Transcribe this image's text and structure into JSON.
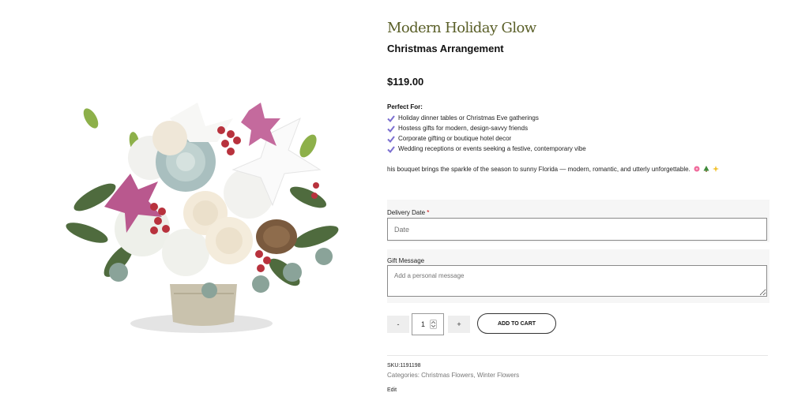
{
  "product": {
    "title": "Modern Holiday Glow",
    "subtitle": "Christmas Arrangement",
    "price": "$119.00"
  },
  "perfect_for": {
    "heading": "Perfect For:",
    "items": [
      "Holiday dinner tables or Christmas Eve gatherings",
      "Hostess gifts for modern, design-savvy friends",
      "Corporate gifting or boutique hotel decor",
      "Wedding receptions or events seeking a festive, contemporary vibe"
    ]
  },
  "description": {
    "text": "his bouquet brings the sparkle of the season to sunny Florida — modern, romantic, and utterly unforgettable."
  },
  "form": {
    "delivery_date": {
      "label": "Delivery Date",
      "required_mark": "*",
      "placeholder": "Date"
    },
    "gift_message": {
      "label": "Gift Message",
      "placeholder": "Add a personal message"
    }
  },
  "cart": {
    "minus_label": "-",
    "quantity": "1",
    "plus_label": "+",
    "add_to_cart_label": "ADD TO CART"
  },
  "meta": {
    "sku_label": "SKU:",
    "sku_value": "1191198",
    "categories_label": "Categories:",
    "categories": [
      "Christmas Flowers",
      "Winter Flowers"
    ],
    "edit_label": "Edit"
  },
  "icons": {
    "check": "checkmark-icon",
    "zoom": "fullscreen-icon"
  },
  "colors": {
    "title": "#5a5f28",
    "check": "#7b6fd0",
    "required": "#cc0000"
  }
}
